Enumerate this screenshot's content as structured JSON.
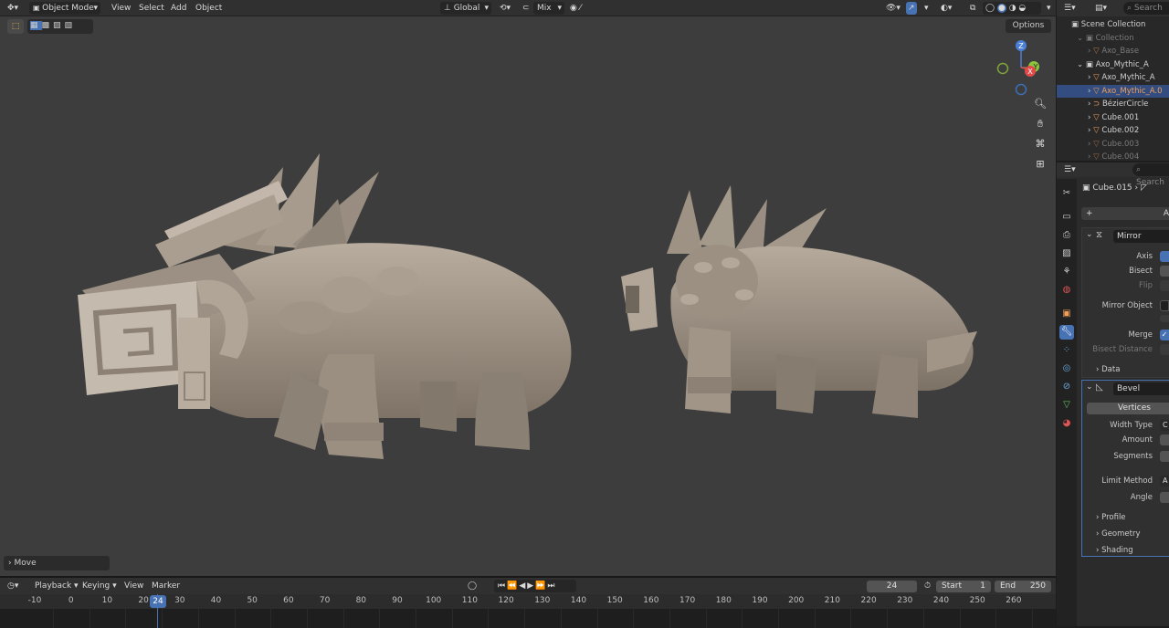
{
  "header": {
    "mode": "Object Mode",
    "menus": [
      "View",
      "Select",
      "Add",
      "Object"
    ],
    "orientation": "Global",
    "snap": "Mix",
    "options": "Options"
  },
  "viewport": {
    "operator_panel": "Move",
    "gizmo": {
      "z": "Z",
      "y": "Y",
      "x": "X"
    }
  },
  "timeline": {
    "menus": [
      "Playback",
      "Keying",
      "View",
      "Marker"
    ],
    "current_frame": "24",
    "start_label": "Start",
    "start": "1",
    "end_label": "End",
    "end": "250",
    "ticks": [
      "-10",
      "0",
      "10",
      "20",
      "30",
      "40",
      "50",
      "60",
      "70",
      "80",
      "90",
      "100",
      "110",
      "120",
      "130",
      "140",
      "150",
      "160",
      "170",
      "180",
      "190",
      "200",
      "210",
      "220",
      "230",
      "240",
      "250",
      "260"
    ],
    "playhead": "24"
  },
  "outliner": {
    "search": "Search",
    "items": [
      {
        "label": "Scene Collection",
        "dim": false
      },
      {
        "label": "Collection",
        "dim": true
      },
      {
        "label": "Axo_Base",
        "dim": true
      },
      {
        "label": "Axo_Mythic_A",
        "dim": false
      },
      {
        "label": "Axo_Mythic_A",
        "dim": false
      },
      {
        "label": "Axo_Mythic_A.0",
        "dim": false,
        "active": true
      },
      {
        "label": "BézierCircle",
        "dim": false
      },
      {
        "label": "Cube.001",
        "dim": false
      },
      {
        "label": "Cube.002",
        "dim": false
      },
      {
        "label": "Cube.003",
        "dim": true
      },
      {
        "label": "Cube.004",
        "dim": true
      }
    ]
  },
  "properties": {
    "search": "Search",
    "object": "Cube.015",
    "add_modifier": "A",
    "mirror": {
      "name": "Mirror",
      "axis": "Axis",
      "bisect": "Bisect",
      "flip": "Flip",
      "mirror_object": "Mirror Object",
      "merge": "Merge",
      "bisect_distance": "Bisect Distance",
      "data": "Data"
    },
    "bevel": {
      "name": "Bevel",
      "vertices": "Vertices",
      "width_type": "Width Type",
      "width_type_val": "C",
      "amount": "Amount",
      "segments": "Segments",
      "limit_method": "Limit Method",
      "limit_method_val": "A",
      "angle": "Angle",
      "profile": "Profile",
      "geometry": "Geometry",
      "shading": "Shading"
    }
  },
  "colors": {
    "accent": "#4772b3",
    "active_object": "#f0a05a",
    "mesh": "#a89c8e"
  }
}
